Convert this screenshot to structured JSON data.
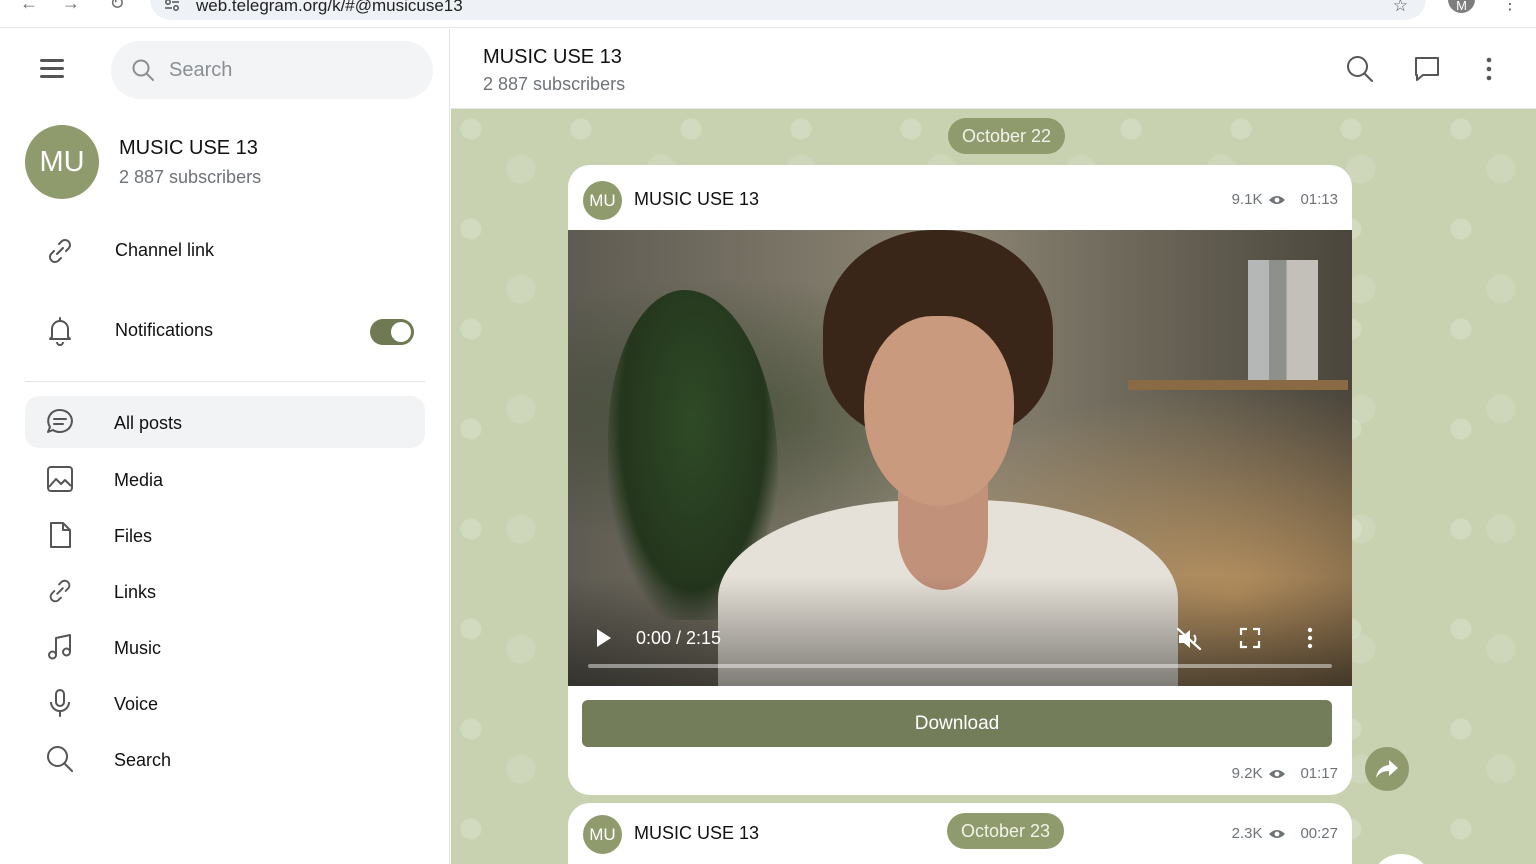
{
  "browser": {
    "url": "web.telegram.org/k/#@musicuse13",
    "profile_initial": "M"
  },
  "sidebar": {
    "search_placeholder": "Search",
    "channel": {
      "avatar_initials": "MU",
      "name": "MUSIC USE 13",
      "subscribers": "2 887 subscribers"
    },
    "info_rows": [
      {
        "label": "Channel link",
        "icon": "link-icon"
      },
      {
        "label": "Notifications",
        "icon": "bell-icon",
        "toggle_on": true
      }
    ],
    "menu": [
      {
        "label": "All posts",
        "icon": "chat-bubble-icon",
        "active": true
      },
      {
        "label": "Media",
        "icon": "image-icon"
      },
      {
        "label": "Files",
        "icon": "file-icon"
      },
      {
        "label": "Links",
        "icon": "link-icon"
      },
      {
        "label": "Music",
        "icon": "music-note-icon"
      },
      {
        "label": "Voice",
        "icon": "microphone-icon"
      },
      {
        "label": "Search",
        "icon": "search-icon"
      }
    ]
  },
  "header": {
    "title": "MUSIC USE 13",
    "subtitle": "2 887 subscribers"
  },
  "chat": {
    "date_1": "October 22",
    "date_2": "October 23",
    "post_1": {
      "avatar_initials": "MU",
      "author": "MUSIC USE 13",
      "views": "9.1K",
      "time": "01:13",
      "video_time": "0:00 / 2:15",
      "video_progress": 0,
      "download_label": "Download",
      "footer_views": "9.2K",
      "footer_time": "01:17"
    },
    "post_2": {
      "avatar_initials": "MU",
      "author": "MUSIC USE 13",
      "views": "2.3K",
      "time": "00:27"
    }
  },
  "colors": {
    "accent": "#8f9a6d",
    "button": "#747d5a",
    "chat_bg": "#c8d2b1"
  }
}
